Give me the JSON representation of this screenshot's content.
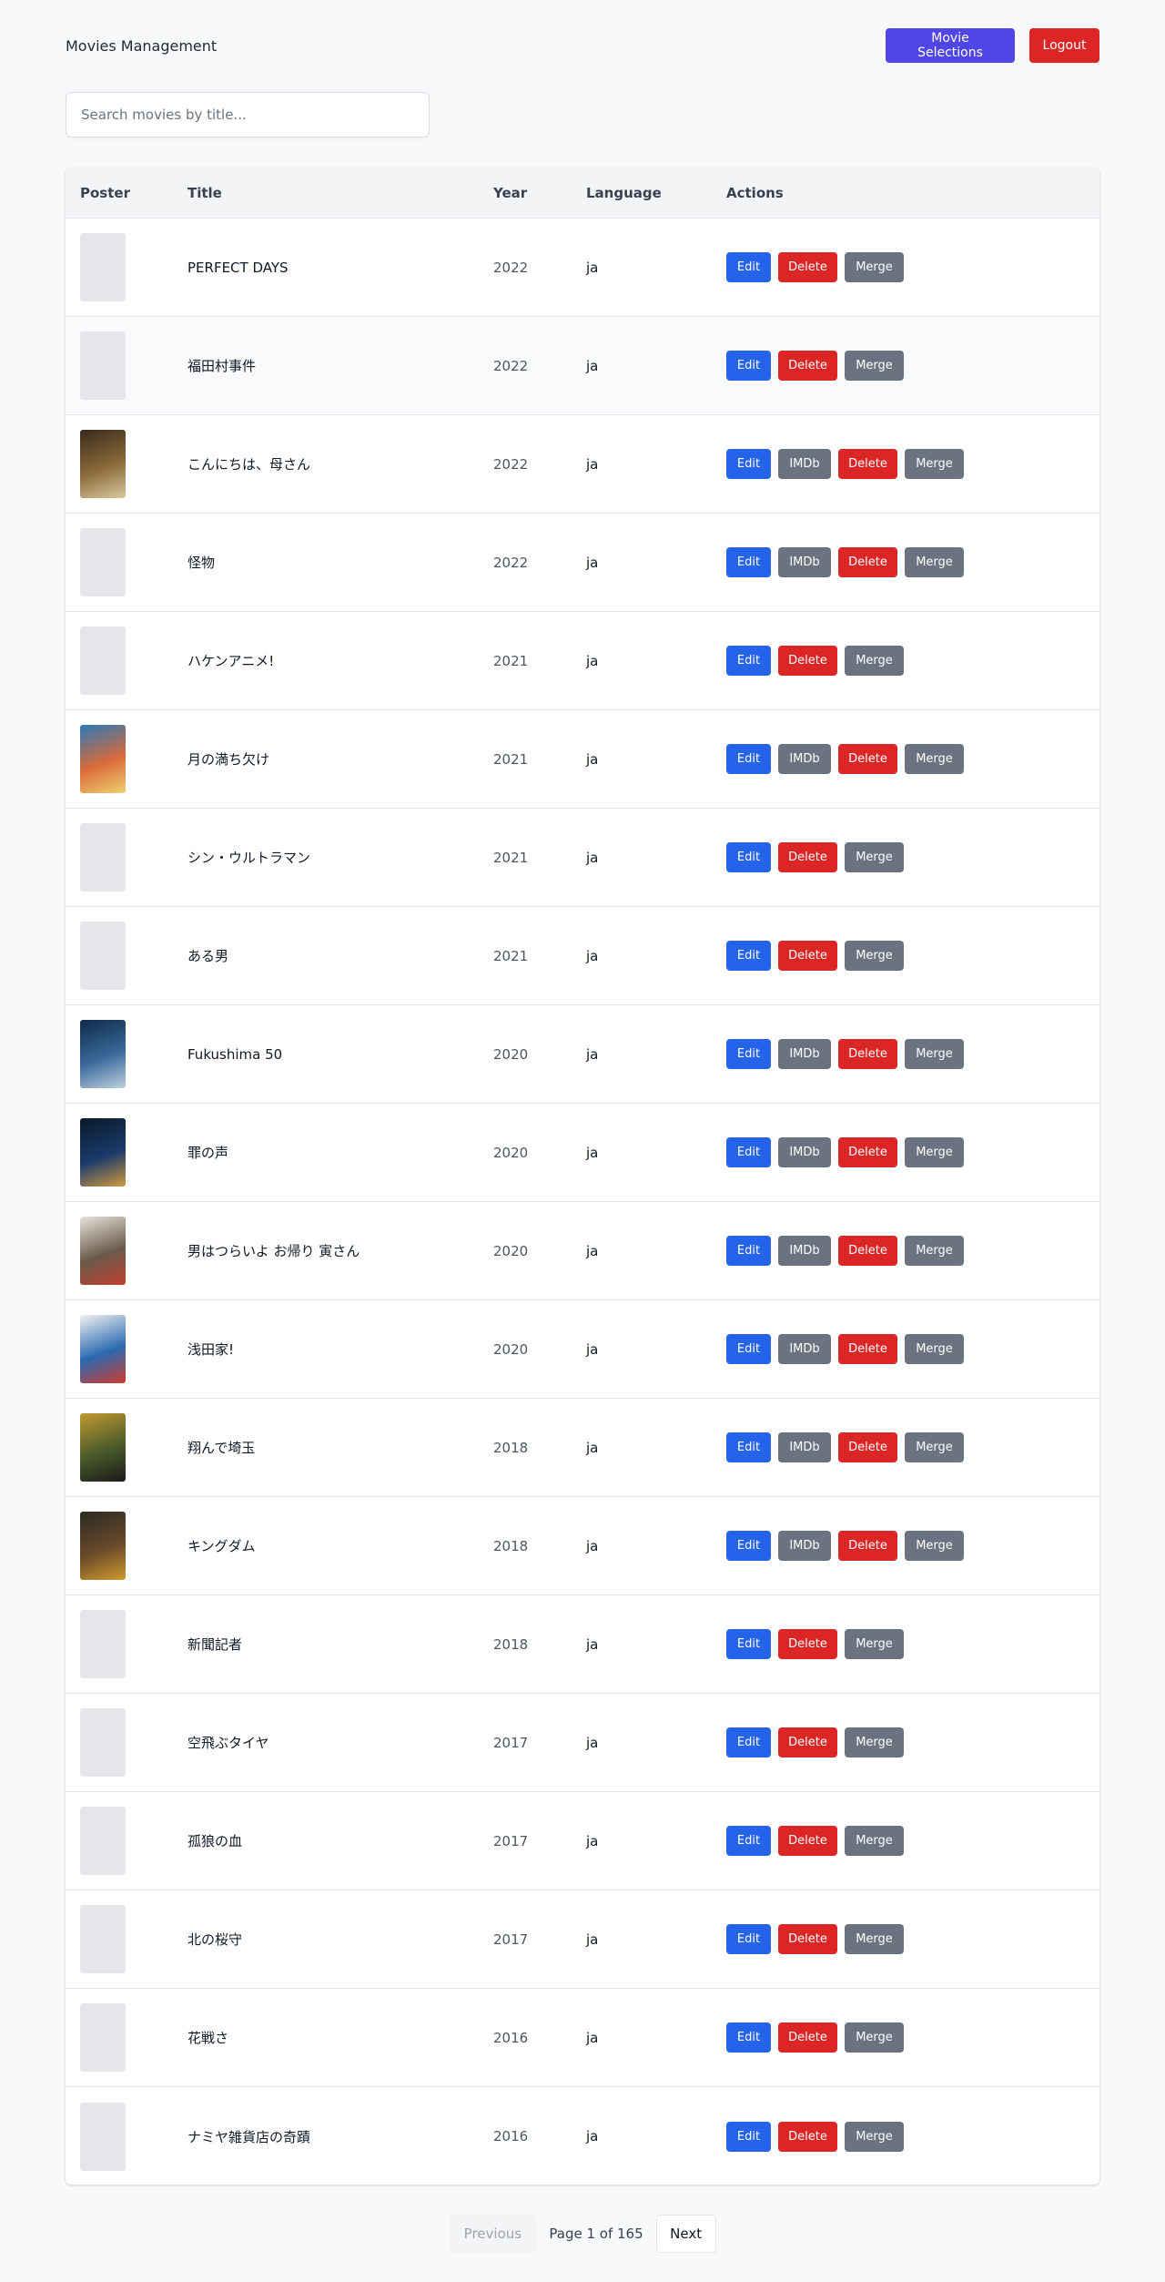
{
  "header": {
    "title": "Movies Management",
    "movie_selections_label": "Movie Selections",
    "logout_label": "Logout"
  },
  "search": {
    "placeholder": "Search movies by title...",
    "value": ""
  },
  "table": {
    "columns": [
      "Poster",
      "Title",
      "Year",
      "Language",
      "Actions"
    ],
    "action_labels": {
      "edit": "Edit",
      "imdb": "IMDb",
      "delete": "Delete",
      "merge": "Merge"
    },
    "rows": [
      {
        "title": "PERFECT DAYS",
        "year": "2022",
        "language": "ja",
        "has_poster": false,
        "has_imdb": false,
        "poster_colors": []
      },
      {
        "title": "福田村事件",
        "year": "2022",
        "language": "ja",
        "has_poster": false,
        "has_imdb": false,
        "poster_colors": []
      },
      {
        "title": "こんにちは、母さん",
        "year": "2022",
        "language": "ja",
        "has_poster": true,
        "has_imdb": true,
        "poster_colors": [
          "#3a2a1c",
          "#8a6a3a",
          "#d9c9a0"
        ]
      },
      {
        "title": "怪物",
        "year": "2022",
        "language": "ja",
        "has_poster": false,
        "has_imdb": true,
        "poster_colors": []
      },
      {
        "title": "ハケンアニメ!",
        "year": "2021",
        "language": "ja",
        "has_poster": false,
        "has_imdb": false,
        "poster_colors": []
      },
      {
        "title": "月の満ち欠け",
        "year": "2021",
        "language": "ja",
        "has_poster": true,
        "has_imdb": true,
        "poster_colors": [
          "#2a7ab8",
          "#d96a3a",
          "#f0d070"
        ]
      },
      {
        "title": "シン・ウルトラマン",
        "year": "2021",
        "language": "ja",
        "has_poster": false,
        "has_imdb": false,
        "poster_colors": []
      },
      {
        "title": "ある男",
        "year": "2021",
        "language": "ja",
        "has_poster": false,
        "has_imdb": false,
        "poster_colors": []
      },
      {
        "title": "Fukushima 50",
        "year": "2020",
        "language": "ja",
        "has_poster": true,
        "has_imdb": true,
        "poster_colors": [
          "#0f2a4a",
          "#3a6a9a",
          "#c0d0e0"
        ]
      },
      {
        "title": "罪の声",
        "year": "2020",
        "language": "ja",
        "has_poster": true,
        "has_imdb": true,
        "poster_colors": [
          "#0a1a2a",
          "#1a3a6a",
          "#d09a40"
        ]
      },
      {
        "title": "男はつらいよ お帰り 寅さん",
        "year": "2020",
        "language": "ja",
        "has_poster": true,
        "has_imdb": true,
        "poster_colors": [
          "#e8e4dc",
          "#6a5a4a",
          "#c04030"
        ]
      },
      {
        "title": "浅田家!",
        "year": "2020",
        "language": "ja",
        "has_poster": true,
        "has_imdb": true,
        "poster_colors": [
          "#f2f2f2",
          "#2a6ab0",
          "#d03a30"
        ]
      },
      {
        "title": "翔んで埼玉",
        "year": "2018",
        "language": "ja",
        "has_poster": true,
        "has_imdb": true,
        "poster_colors": [
          "#c09a30",
          "#4a5a2a",
          "#1a1a1a"
        ]
      },
      {
        "title": "キングダム",
        "year": "2018",
        "language": "ja",
        "has_poster": true,
        "has_imdb": true,
        "poster_colors": [
          "#2a2a24",
          "#6a4a2a",
          "#d09a30"
        ]
      },
      {
        "title": "新聞記者",
        "year": "2018",
        "language": "ja",
        "has_poster": false,
        "has_imdb": false,
        "poster_colors": []
      },
      {
        "title": "空飛ぶタイヤ",
        "year": "2017",
        "language": "ja",
        "has_poster": false,
        "has_imdb": false,
        "poster_colors": []
      },
      {
        "title": "孤狼の血",
        "year": "2017",
        "language": "ja",
        "has_poster": false,
        "has_imdb": false,
        "poster_colors": []
      },
      {
        "title": "北の桜守",
        "year": "2017",
        "language": "ja",
        "has_poster": false,
        "has_imdb": false,
        "poster_colors": []
      },
      {
        "title": "花戦さ",
        "year": "2016",
        "language": "ja",
        "has_poster": false,
        "has_imdb": false,
        "poster_colors": []
      },
      {
        "title": "ナミヤ雑貨店の奇蹟",
        "year": "2016",
        "language": "ja",
        "has_poster": false,
        "has_imdb": false,
        "poster_colors": []
      }
    ]
  },
  "pagination": {
    "previous_label": "Previous",
    "page_info": "Page 1 of 165",
    "next_label": "Next"
  },
  "colors": {
    "primary": "#2563eb",
    "danger": "#dc2626",
    "secondary": "#6b7280",
    "accent": "#4f46e5"
  }
}
